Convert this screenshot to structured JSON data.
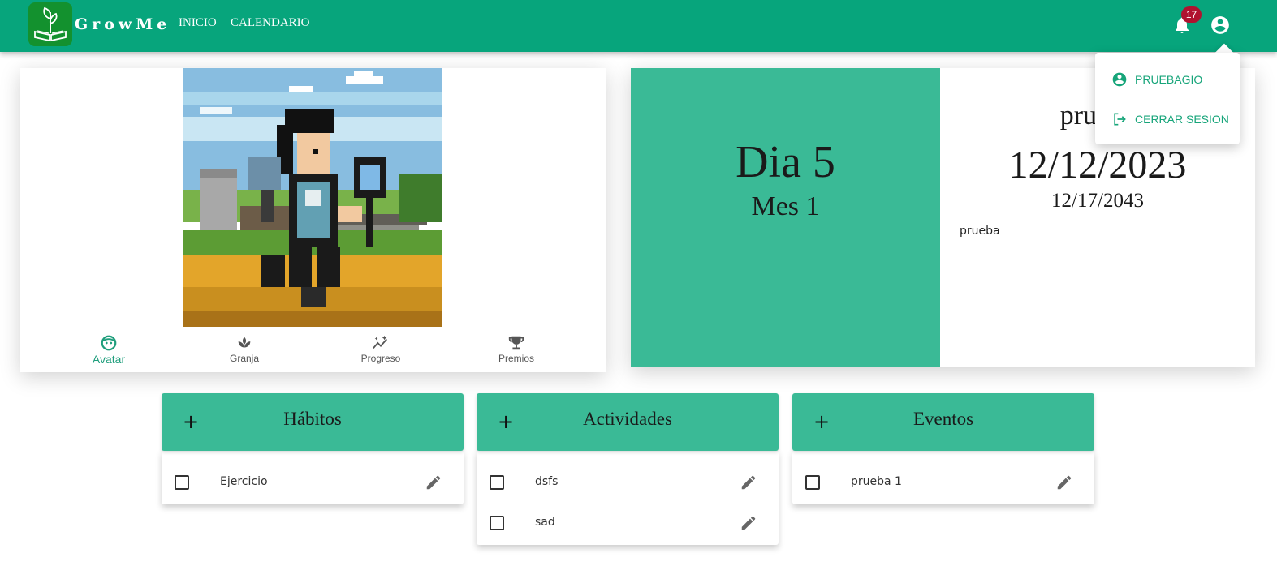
{
  "app": {
    "brand": "GrowMe",
    "nav": [
      {
        "label": "INICIO"
      },
      {
        "label": "CALENDARIO"
      }
    ],
    "notifications_count": "17",
    "accent_color": "#07a57c",
    "card_color": "#3aba96",
    "badge_color": "#b0122f"
  },
  "account_menu": {
    "items": [
      {
        "label": "PRUEBAGIO",
        "icon": "account-circle-icon"
      },
      {
        "label": "CERRAR SESION",
        "icon": "logout-icon"
      }
    ]
  },
  "avatar_card": {
    "image_alt": "pixel-art avatar in farm scene",
    "tabs": [
      {
        "label": "Avatar",
        "icon": "face-icon",
        "active": true
      },
      {
        "label": "Granja",
        "icon": "plant-icon",
        "active": false
      },
      {
        "label": "Progreso",
        "icon": "chart-sparkle-icon",
        "active": false
      },
      {
        "label": "Premios",
        "icon": "trophy-icon",
        "active": false
      }
    ]
  },
  "calendar_card": {
    "day": "Dia 5",
    "month": "Mes 1",
    "name": "prueba",
    "date": "12/12/2023",
    "end_date": "12/17/2043",
    "description": "prueba"
  },
  "lists": {
    "habitos": {
      "title": "Hábitos",
      "add_label": "+",
      "items": [
        {
          "label": "Ejercicio"
        }
      ]
    },
    "actividades": {
      "title": "Actividades",
      "add_label": "+",
      "items": [
        {
          "label": "dsfs"
        },
        {
          "label": "sad"
        }
      ]
    },
    "eventos": {
      "title": "Eventos",
      "add_label": "+",
      "items": [
        {
          "label": "prueba 1"
        }
      ]
    }
  }
}
